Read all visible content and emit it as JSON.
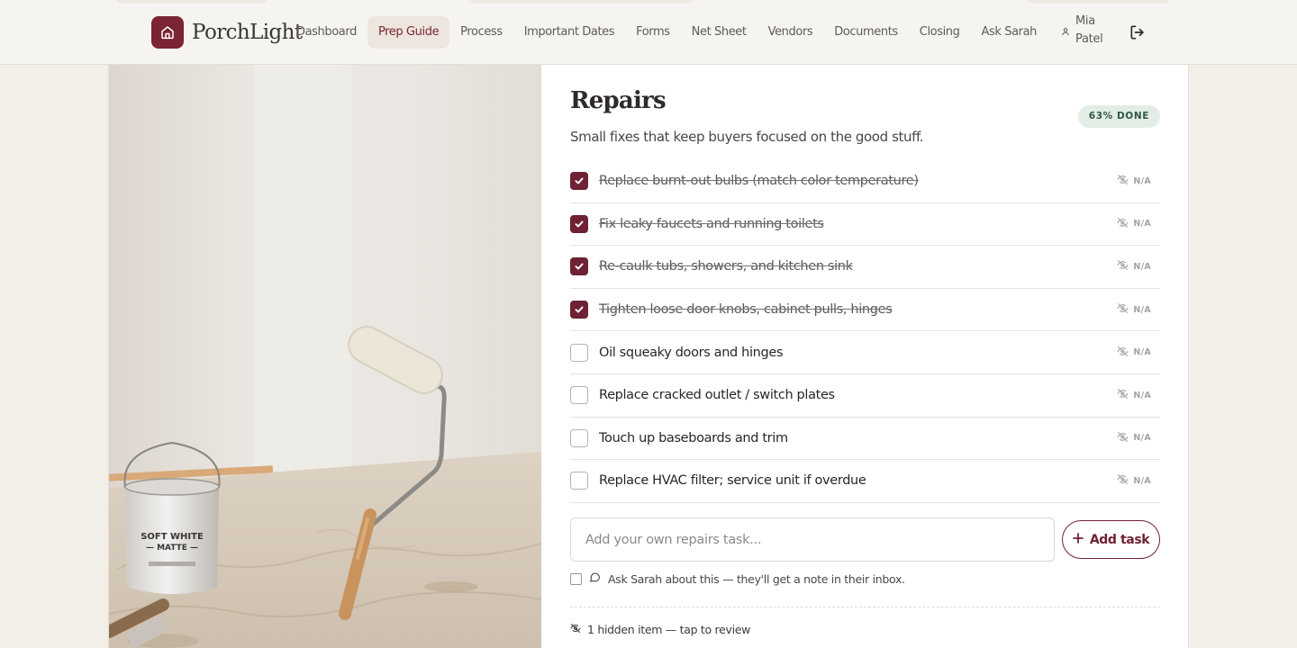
{
  "app": {
    "brand": "PorchLight",
    "icons": {
      "logo": "house-icon",
      "user": "user-icon",
      "logout": "logout-icon"
    },
    "colors": {
      "brand": "#7a2434",
      "accent": "#6e2233",
      "done_badge_bg": "#e4ece6",
      "done_badge_text": "#2f5a42"
    }
  },
  "nav": {
    "items": [
      {
        "label": "Dashboard",
        "active": false
      },
      {
        "label": "Prep Guide",
        "active": true
      },
      {
        "label": "Process",
        "active": false
      },
      {
        "label": "Important Dates",
        "active": false
      },
      {
        "label": "Forms",
        "active": false
      },
      {
        "label": "Net Sheet",
        "active": false
      },
      {
        "label": "Vendors",
        "active": false
      },
      {
        "label": "Documents",
        "active": false
      },
      {
        "label": "Closing",
        "active": false
      },
      {
        "label": "Ask Sarah",
        "active": false
      }
    ],
    "user_name": "Mia Patel"
  },
  "section": {
    "title": "Repairs",
    "subtitle": "Small fixes that keep buyers focused on the good stuff.",
    "progress_label": "63% DONE",
    "progress_percent": 63
  },
  "tasks": [
    {
      "label": "Replace burnt-out bulbs (match color temperature)",
      "done": true,
      "na_label": "N/A"
    },
    {
      "label": "Fix leaky faucets and running toilets",
      "done": true,
      "na_label": "N/A"
    },
    {
      "label": "Re-caulk tubs, showers, and kitchen sink",
      "done": true,
      "na_label": "N/A"
    },
    {
      "label": "Tighten loose door knobs, cabinet pulls, hinges",
      "done": true,
      "na_label": "N/A"
    },
    {
      "label": "Oil squeaky doors and hinges",
      "done": false,
      "na_label": "N/A"
    },
    {
      "label": "Replace cracked outlet / switch plates",
      "done": false,
      "na_label": "N/A"
    },
    {
      "label": "Touch up baseboards and trim",
      "done": false,
      "na_label": "N/A"
    },
    {
      "label": "Replace HVAC filter; service unit if overdue",
      "done": false,
      "na_label": "N/A"
    }
  ],
  "add_task": {
    "placeholder": "Add your own repairs task...",
    "value": "",
    "button_label": "Add task"
  },
  "ask_sarah": {
    "label": "Ask Sarah about this — they'll get a note in their inbox.",
    "checked": false
  },
  "hidden_items": {
    "label": "1 hidden item — tap to review"
  },
  "photo": {
    "paint_can_line1": "SOFT WHITE",
    "paint_can_line2": "— MATTE —"
  }
}
